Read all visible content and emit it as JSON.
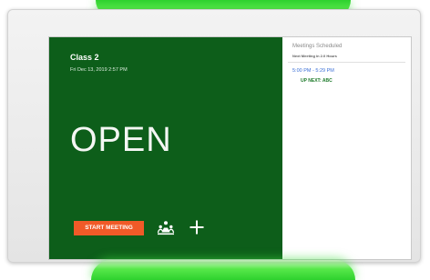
{
  "room": {
    "name": "Class 2",
    "datetime": "Fri Dec 13, 2019 2:57 PM",
    "status": "OPEN"
  },
  "actions": {
    "start_meeting_label": "START MEETING",
    "people_icon": "people-group-icon",
    "add_icon": "plus-icon"
  },
  "meetings": {
    "title": "Meetings Scheduled",
    "subtitle": "Next Meeting in 2.0 Hours",
    "items": [
      {
        "time": "5:00 PM - 5:29 PM",
        "label": "UP NEXT: ABC"
      }
    ]
  },
  "colors": {
    "status_open": "#0d5e1a",
    "start_button": "#f05a28",
    "led_glow": "#2ed12e",
    "meeting_time": "#3b6fd6",
    "up_next": "#1d7a2a"
  }
}
